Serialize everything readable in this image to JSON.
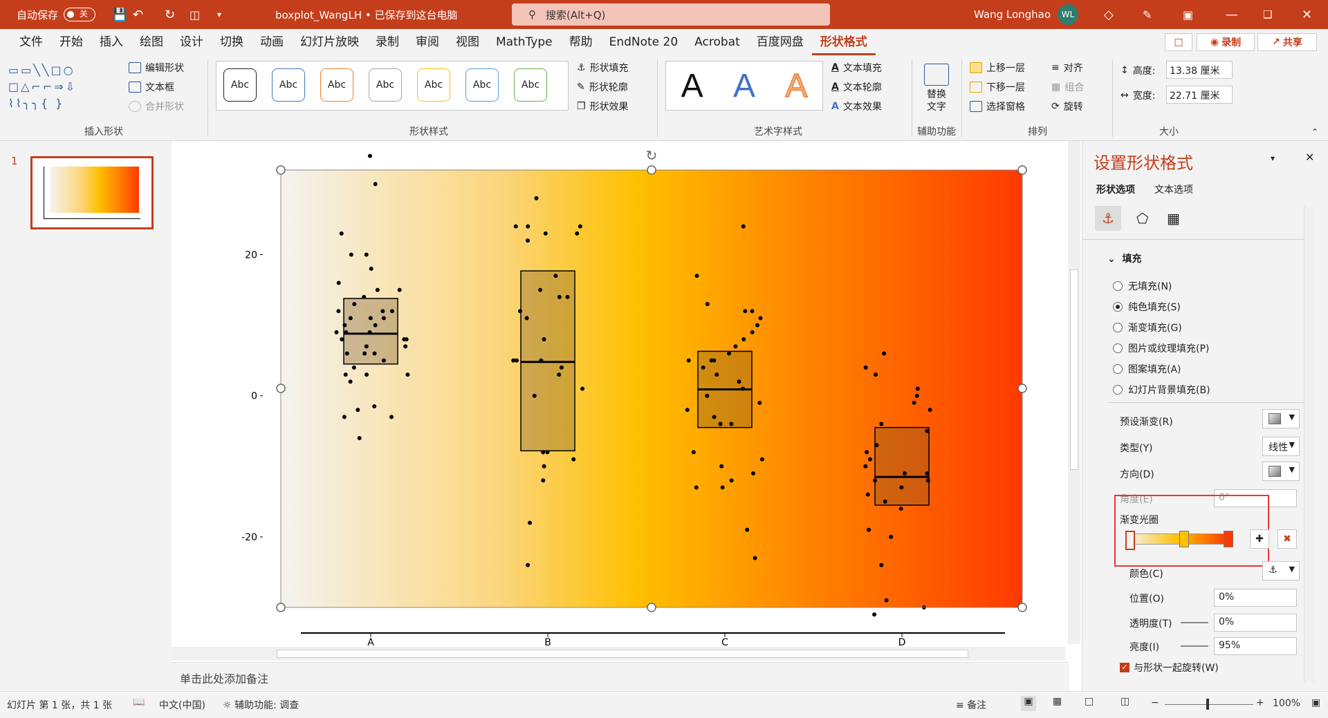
{
  "titlebar": {
    "autosave_label": "自动保存",
    "autosave_state": "关",
    "filename": "boxplot_WangLH • 已保存到这台电脑",
    "search_placeholder": "搜索(Alt+Q)",
    "user_name": "Wang Longhao",
    "user_initials": "WL"
  },
  "menu": [
    "文件",
    "开始",
    "插入",
    "绘图",
    "设计",
    "切换",
    "动画",
    "幻灯片放映",
    "录制",
    "审阅",
    "视图",
    "MathType",
    "帮助",
    "EndNote 20",
    "Acrobat",
    "百度网盘",
    "形状格式"
  ],
  "menu_active": "形状格式",
  "menu_right": {
    "record": "录制",
    "share": "共享"
  },
  "ribbon": {
    "insert_shapes": {
      "edit_shape": "编辑形状",
      "text_box": "文本框",
      "merge_shapes": "合并形状",
      "label": "插入形状"
    },
    "shape_styles": {
      "sample": "Abc",
      "fill": "形状填充",
      "outline": "形状轮廓",
      "effects": "形状效果",
      "label": "形状样式",
      "swatch_colors": [
        "#222222",
        "#4472c4",
        "#ed7d31",
        "#a5a5a5",
        "#ffc000",
        "#5b9bd5",
        "#70ad47"
      ]
    },
    "wordart": {
      "letter": "A",
      "text_fill": "文本填充",
      "text_outline": "文本轮廓",
      "text_effects": "文本效果",
      "label": "艺术字样式"
    },
    "accessibility": {
      "alt_text_line1": "替换",
      "alt_text_line2": "文字",
      "label": "辅助功能"
    },
    "arrange": {
      "bring_forward": "上移一层",
      "send_backward": "下移一层",
      "selection_pane": "选择窗格",
      "align": "对齐",
      "group": "组合",
      "rotate": "旋转",
      "label": "排列"
    },
    "size": {
      "height_label": "高度:",
      "height_value": "13.38 厘米",
      "width_label": "宽度:",
      "width_value": "22.71 厘米",
      "label": "大小"
    }
  },
  "slides": {
    "number": "1"
  },
  "chart_data": {
    "type": "box",
    "categories": [
      "A",
      "B",
      "C",
      "D"
    ],
    "yticks": [
      20,
      0,
      -20
    ],
    "ylim": [
      -30,
      32
    ],
    "boxes": [
      {
        "category": "A",
        "q1": 4.5,
        "median": 8.8,
        "q3": 13.8
      },
      {
        "category": "B",
        "q1": -7.8,
        "median": 4.8,
        "q3": 17.7
      },
      {
        "category": "C",
        "q1": -4.5,
        "median": 0.9,
        "q3": 6.3
      },
      {
        "category": "D",
        "q1": -15.5,
        "median": -11.5,
        "q3": -4.5
      }
    ],
    "points": [
      {
        "category": "A",
        "values": [
          34,
          30,
          23,
          20,
          20,
          18,
          16,
          15,
          15,
          14,
          13,
          12,
          12,
          12,
          11,
          11,
          11,
          10,
          10,
          9,
          9,
          9,
          8,
          8,
          8,
          7,
          7,
          6,
          6,
          6,
          5,
          4,
          3,
          3,
          3,
          2,
          -1.5,
          -2,
          -3,
          -3,
          -6
        ]
      },
      {
        "category": "B",
        "values": [
          28,
          24,
          24,
          24,
          23,
          23,
          22,
          17,
          15,
          14,
          14,
          12,
          11,
          8,
          5,
          5,
          5,
          4,
          3,
          1,
          0,
          -8,
          -8,
          -8,
          -9,
          -10,
          -12,
          -18,
          -24
        ]
      },
      {
        "category": "C",
        "values": [
          24,
          17,
          13,
          12,
          12,
          11,
          10,
          9,
          8,
          7,
          6,
          5,
          5,
          5,
          4,
          3,
          2,
          1,
          0,
          -1,
          -2,
          -3,
          -4,
          -4,
          -8,
          -9,
          -10,
          -11,
          -12,
          -13,
          -13,
          -19,
          -23
        ]
      },
      {
        "category": "D",
        "values": [
          6,
          4,
          3,
          1,
          0,
          -1,
          -2,
          -4,
          -5,
          -7,
          -8,
          -9,
          -10,
          -11,
          -11,
          -12,
          -12,
          -13,
          -14,
          -15,
          -16,
          -19,
          -20,
          -24,
          -29,
          -30,
          -31
        ]
      }
    ],
    "gradient_colors": [
      "#f5f3ef",
      "#fbd57a",
      "#ffc000",
      "#ff7a00",
      "#ff3a00"
    ]
  },
  "notes_placeholder": "单击此处添加备注",
  "pane": {
    "title": "设置形状格式",
    "tab_shape": "形状选项",
    "tab_text": "文本选项",
    "section": "填充",
    "options": [
      "无填充(N)",
      "纯色填充(S)",
      "渐变填充(G)",
      "图片或纹理填充(P)",
      "图案填充(A)",
      "幻灯片背景填充(B)"
    ],
    "selected_option": "纯色填充(S)",
    "preset_label": "预设渐变(R)",
    "type_label": "类型(Y)",
    "type_value": "线性",
    "direction_label": "方向(D)",
    "angle_label": "角度(E)",
    "angle_value": "0°",
    "stops_label": "渐变光圈",
    "color_label": "颜色(C)",
    "position_label": "位置(O)",
    "position_value": "0%",
    "transparency_label": "透明度(T)",
    "transparency_value": "0%",
    "brightness_label": "亮度(I)",
    "brightness_value": "95%",
    "rotate_label": "与形状一起旋转(W)"
  },
  "status": {
    "slide_info": "幻灯片 第 1 张，共 1 张",
    "language": "中文(中国)",
    "accessibility": "辅助功能: 调查",
    "notes": "备注",
    "zoom": "100%"
  }
}
